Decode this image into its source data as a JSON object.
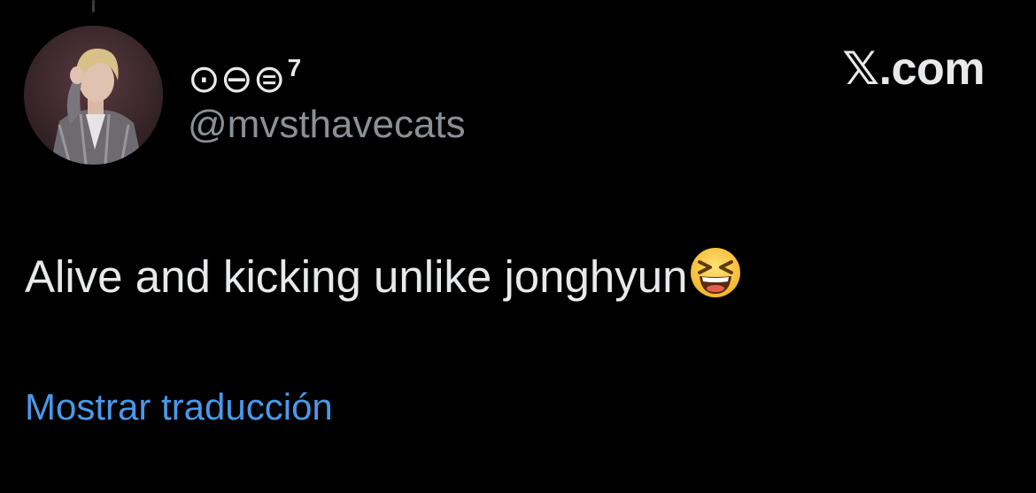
{
  "tweet": {
    "author": {
      "display_name": "⊙⊖⊜",
      "display_name_sup": "7",
      "handle": "@mvsthavecats"
    },
    "brand": "𝕏.com",
    "text": "Alive and kicking unlike jonghyun",
    "emoji_icon": "grinning-squinting-face-emoji",
    "translate_label": "Mostrar traducción"
  },
  "colors": {
    "background": "#000000",
    "primary_text": "#e7e9ea",
    "secondary_text": "#8b9095",
    "link": "#4a99e9"
  }
}
